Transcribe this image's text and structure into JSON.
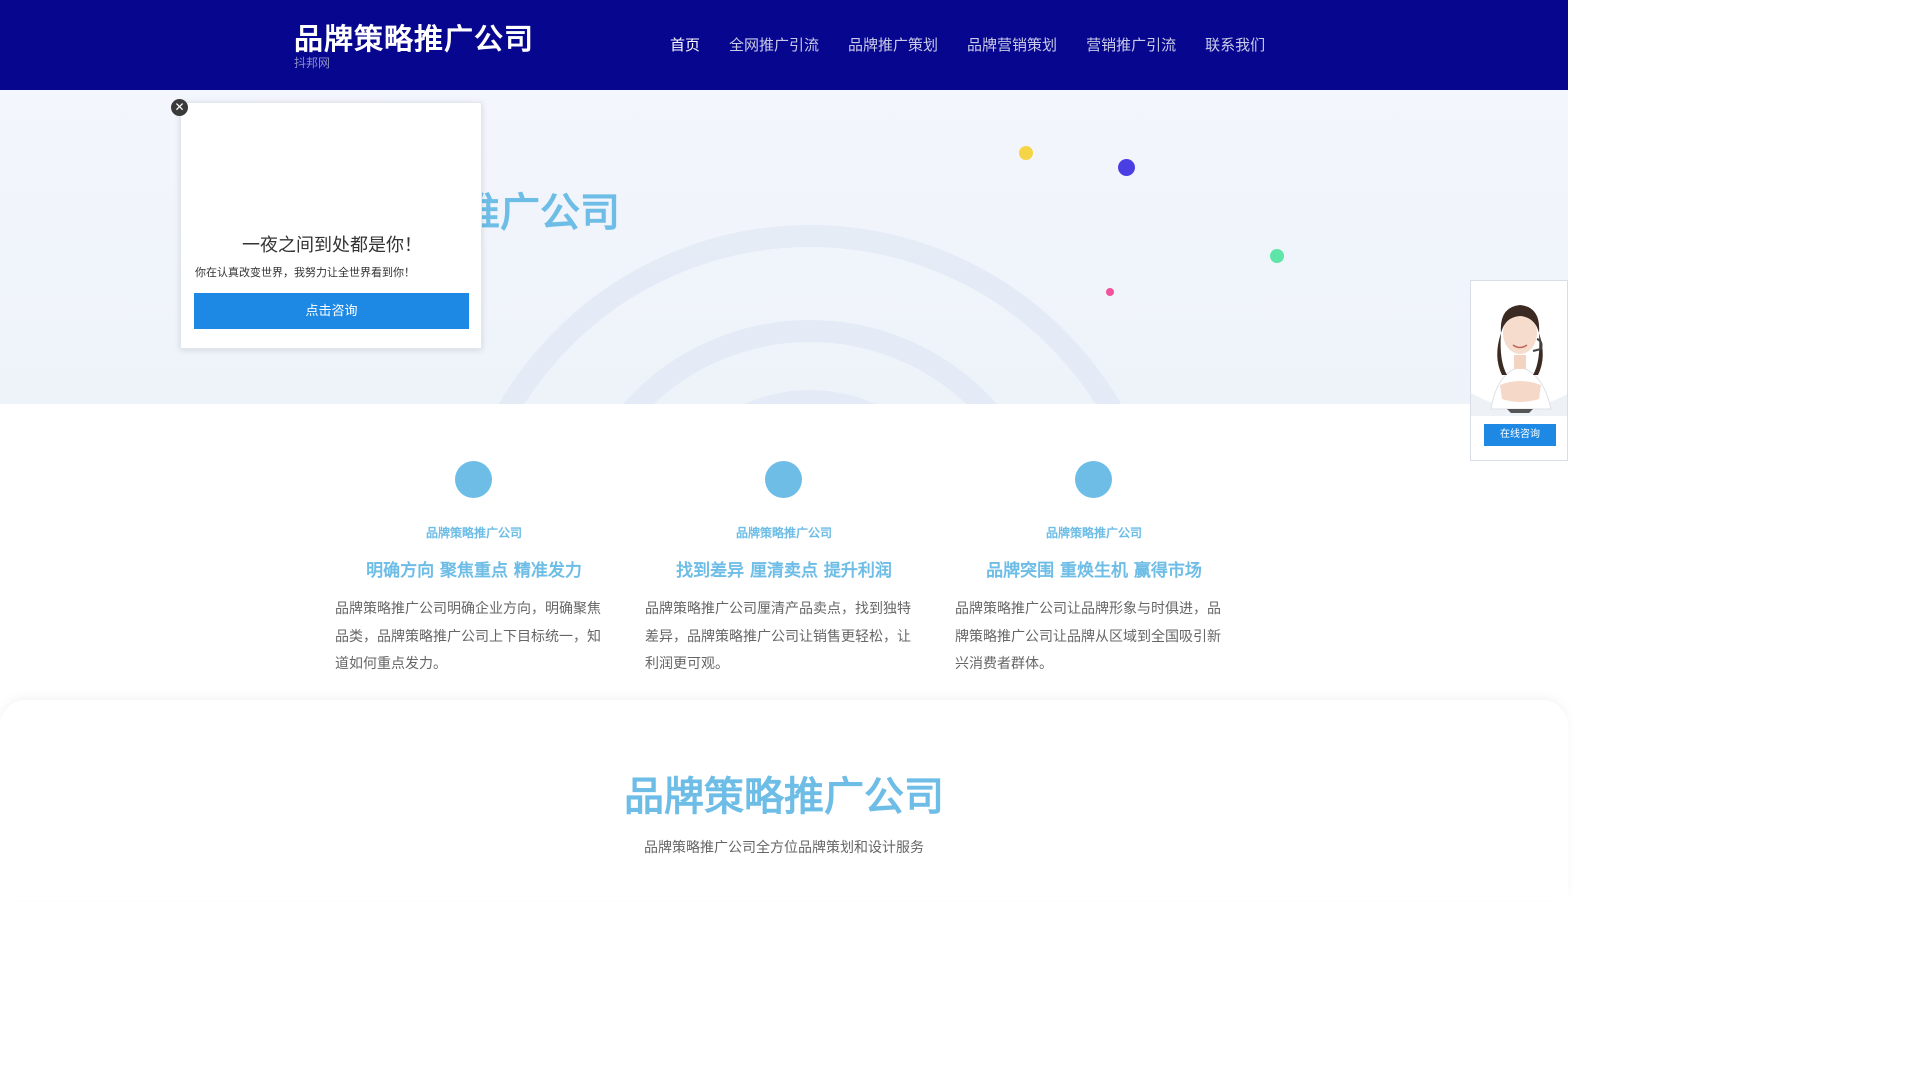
{
  "header": {
    "brand_title": "品牌策略推广公司",
    "brand_sub": "抖邦网",
    "nav": [
      {
        "label": "首页"
      },
      {
        "label": "全网推广引流"
      },
      {
        "label": "品牌推广策划"
      },
      {
        "label": "品牌营销策划"
      },
      {
        "label": "营销推广引流"
      },
      {
        "label": "联系我们"
      }
    ]
  },
  "hero": {
    "title": "品牌策略推广公司"
  },
  "popup": {
    "close_glyph": "✕",
    "heading": "一夜之间到处都是你！",
    "desc": "你在认真改变世界，我努力让全世界看到你！",
    "button": "点击咨询"
  },
  "consult": {
    "button": "在线咨询"
  },
  "features": [
    {
      "label": "品牌策略推广公司",
      "title": "明确方向 聚焦重点 精准发力",
      "desc": "品牌策略推广公司明确企业方向，明确聚焦品类，品牌策略推广公司上下目标统一，知道如何重点发力。"
    },
    {
      "label": "品牌策略推广公司",
      "title": "找到差异 厘清卖点 提升利润",
      "desc": "品牌策略推广公司厘清产品卖点，找到独特差异，品牌策略推广公司让销售更轻松，让利润更可观。"
    },
    {
      "label": "品牌策略推广公司",
      "title": "品牌突围 重焕生机 赢得市场",
      "desc": "品牌策略推广公司让品牌形象与时俱进，品牌策略推广公司让品牌从区域到全国吸引新兴消费者群体。"
    }
  ],
  "section2": {
    "title": "品牌策略推广公司",
    "subtitle": "品牌策略推广公司全方位品牌策划和设计服务"
  },
  "colors": {
    "header_bg": "#07068f",
    "accent": "#6dbde6",
    "button": "#1e88e5"
  }
}
